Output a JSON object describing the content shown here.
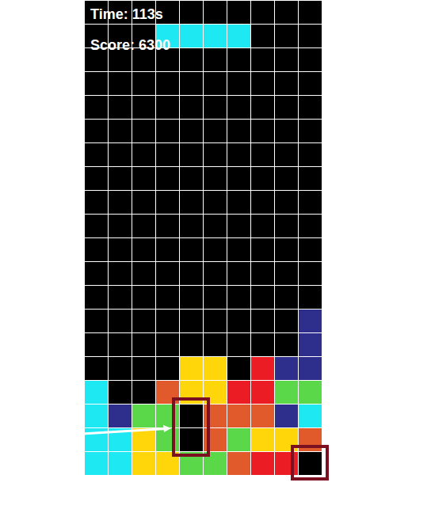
{
  "hud": {
    "time": "Time: 113s",
    "score": "Score: 6300"
  },
  "palette": {
    "C": "#1ee9f2",
    "Y": "#ffd60a",
    "R": "#ec1c24",
    "N": "#2e2e8c",
    "G": "#5ad84a",
    "O": "#e05a2b"
  },
  "board": {
    "rows": [
      "..........",
      "...CCCC...",
      "..........",
      "..........",
      "..........",
      "..........",
      "..........",
      "..........",
      "..........",
      "..........",
      "..........",
      "..........",
      "..........",
      ".........N",
      ".........N",
      "....YY.RNN",
      "C..OYYRRGG",
      "CNGG.OOONC",
      "CCYG.OGYYO",
      "CCYYGGORR."
    ]
  },
  "annotations": [
    {
      "kind": "box",
      "row": 17,
      "col": 4,
      "rows": 2,
      "color": "#7b1020"
    },
    {
      "kind": "box",
      "row": 19,
      "col": 9,
      "rows": 1,
      "color": "#7b1020"
    },
    {
      "kind": "arrow",
      "row": 18,
      "col": 4,
      "color": "#ffffff"
    }
  ]
}
